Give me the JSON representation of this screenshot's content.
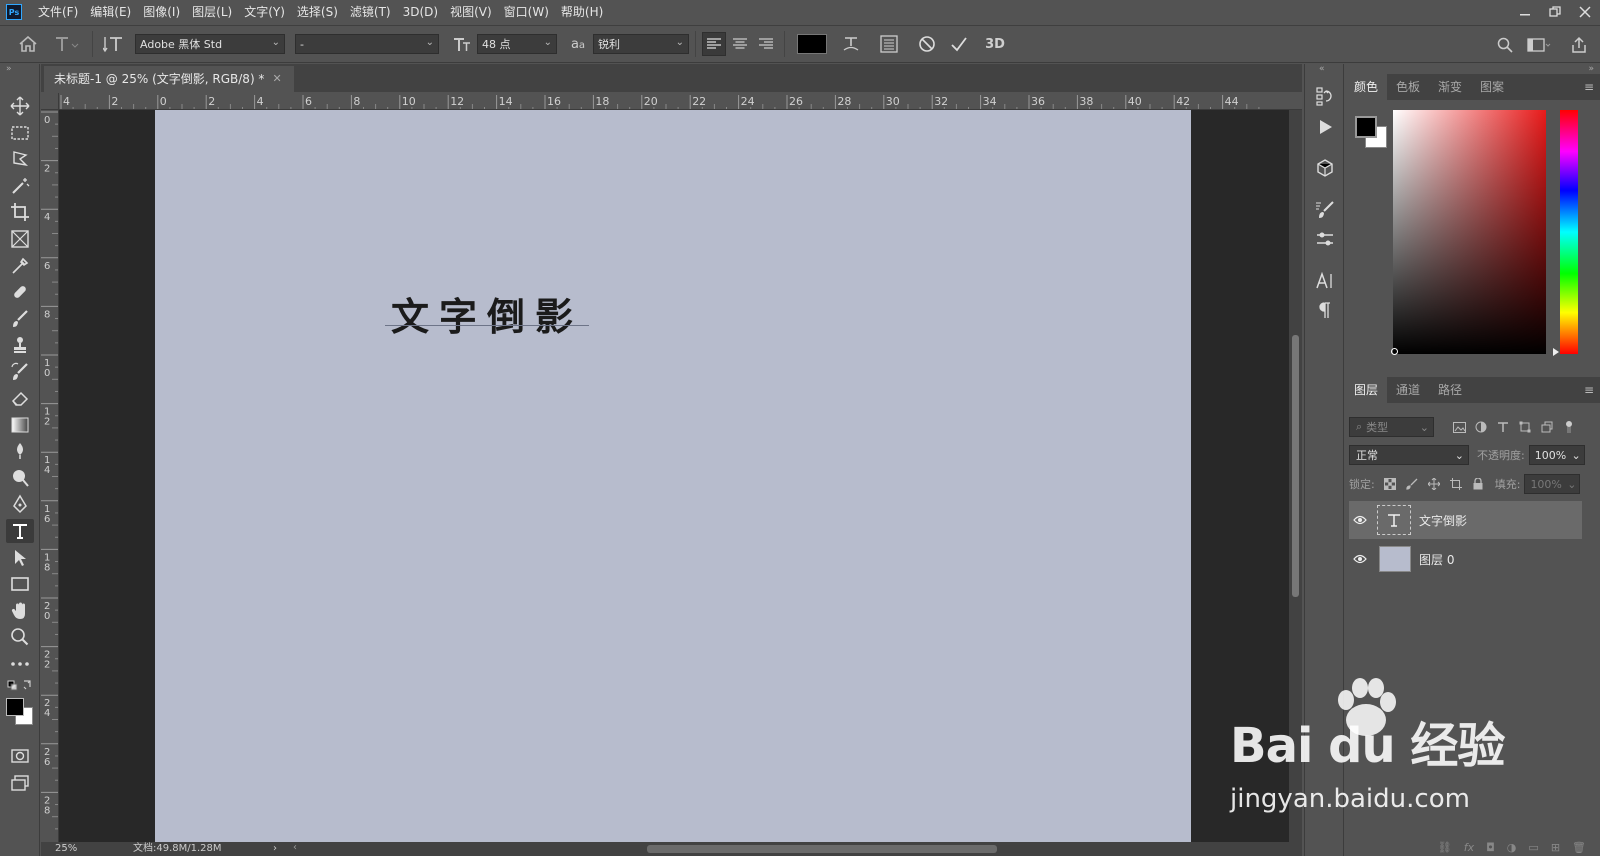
{
  "app": {
    "logo_text": "Ps"
  },
  "menu": [
    "文件(F)",
    "编辑(E)",
    "图像(I)",
    "图层(L)",
    "文字(Y)",
    "选择(S)",
    "滤镜(T)",
    "3D(D)",
    "视图(V)",
    "窗口(W)",
    "帮助(H)"
  ],
  "options_bar": {
    "font_family": "Adobe 黑体 Std",
    "font_style": "-",
    "font_size": "48 点",
    "antialias": "锐利",
    "three_d": "3D",
    "text_color": "#000000"
  },
  "document": {
    "tab_title": "未标题-1 @ 25% (文字倒影, RGB/8) *",
    "canvas_text": "文字倒影",
    "canvas_color": "#b7bccd",
    "h_ruler": [
      "4",
      "2",
      "0",
      "2",
      "4",
      "6",
      "8",
      "10",
      "12",
      "14",
      "16",
      "18",
      "20",
      "22",
      "24",
      "26",
      "28",
      "30",
      "32",
      "34",
      "36",
      "38",
      "40",
      "42",
      "44"
    ],
    "v_ruler": [
      "0",
      "2",
      "4",
      "6",
      "8",
      "1 0",
      "1 2",
      "1 4",
      "1 6",
      "1 8",
      "2 0",
      "2 2",
      "2 4",
      "2 6",
      "2 8"
    ]
  },
  "status": {
    "zoom": "25%",
    "doc_info": "文档:49.8M/1.28M"
  },
  "color_panel": {
    "tabs": [
      "颜色",
      "色板",
      "渐变",
      "图案"
    ],
    "foreground": "#000000",
    "background": "#ffffff"
  },
  "layers_panel": {
    "tabs": [
      "图层",
      "通道",
      "路径"
    ],
    "filter_placeholder": "类型",
    "blend_mode": "正常",
    "opacity_label": "不透明度:",
    "opacity_value": "100%",
    "lock_label": "锁定:",
    "fill_label": "填充:",
    "fill_value": "100%",
    "layers": [
      {
        "name": "文字倒影",
        "type": "text",
        "selected": true
      },
      {
        "name": "图层 0",
        "type": "fill",
        "selected": false
      }
    ]
  },
  "watermark": {
    "brand": "Bai du 经验",
    "url": "jingyan.baidu.com"
  }
}
